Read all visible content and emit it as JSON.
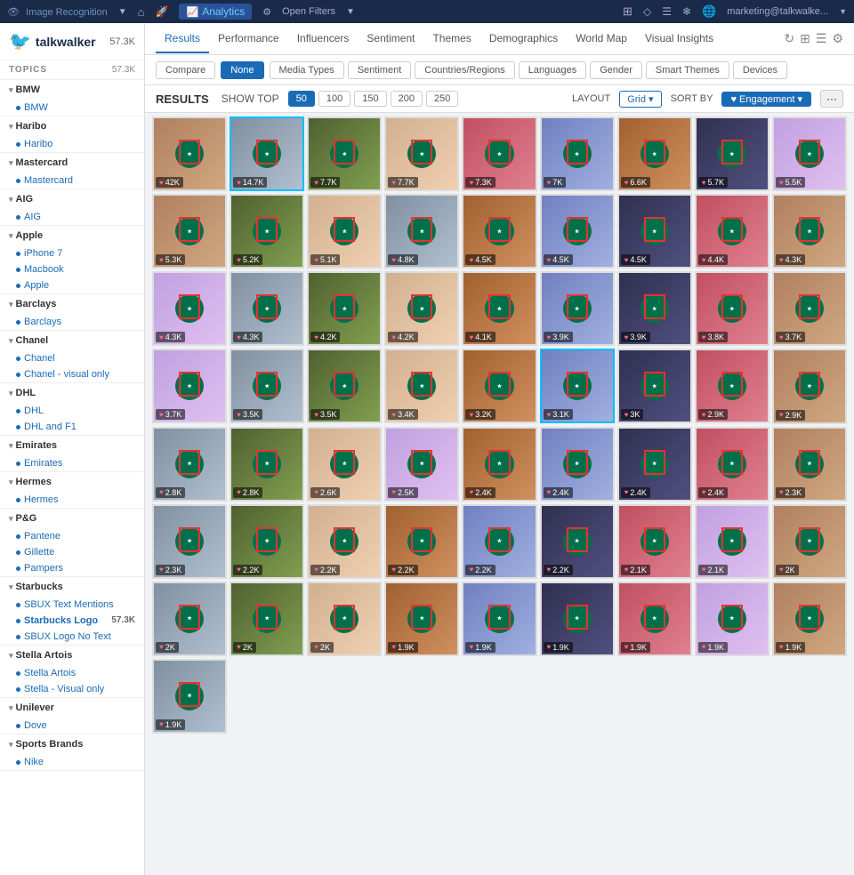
{
  "topnav": {
    "app_name": "Image Recognition",
    "analytics_tab": "Analytics",
    "open_filters": "Open Filters",
    "icons": [
      "home",
      "rocket",
      "analytics",
      "filter",
      "dropdown",
      "grid",
      "diamond",
      "document",
      "snowflake"
    ],
    "user": "marketing@talkwalke...",
    "globe_icon": "🌐"
  },
  "sidebar": {
    "logo_text": "talkwalker",
    "count": "57.3K",
    "topics_label": "TOPICS",
    "groups": [
      {
        "name": "BMW",
        "items": [
          {
            "label": "BMW",
            "count": ""
          }
        ]
      },
      {
        "name": "Haribo",
        "items": [
          {
            "label": "Haribo",
            "count": ""
          }
        ]
      },
      {
        "name": "Mastercard",
        "items": [
          {
            "label": "Mastercard",
            "count": ""
          }
        ]
      },
      {
        "name": "AIG",
        "items": [
          {
            "label": "AIG",
            "count": ""
          }
        ]
      },
      {
        "name": "Apple",
        "items": [
          {
            "label": "iPhone 7",
            "count": ""
          },
          {
            "label": "Macbook",
            "count": ""
          },
          {
            "label": "Apple",
            "count": ""
          }
        ]
      },
      {
        "name": "Barclays",
        "items": [
          {
            "label": "Barclays",
            "count": ""
          }
        ]
      },
      {
        "name": "Chanel",
        "items": [
          {
            "label": "Chanel",
            "count": ""
          },
          {
            "label": "Chanel - visual only",
            "count": ""
          }
        ]
      },
      {
        "name": "DHL",
        "items": [
          {
            "label": "DHL",
            "count": ""
          },
          {
            "label": "DHL and F1",
            "count": ""
          }
        ]
      },
      {
        "name": "Emirates",
        "items": [
          {
            "label": "Emirates",
            "count": ""
          }
        ]
      },
      {
        "name": "Hermes",
        "items": [
          {
            "label": "Hermes",
            "count": ""
          }
        ]
      },
      {
        "name": "P&G",
        "items": [
          {
            "label": "Pantene",
            "count": ""
          },
          {
            "label": "Gillette",
            "count": ""
          },
          {
            "label": "Pampers",
            "count": ""
          }
        ]
      },
      {
        "name": "Starbucks",
        "items": [
          {
            "label": "SBUX Text Mentions",
            "count": ""
          },
          {
            "label": "Starbucks Logo",
            "count": "57.3K",
            "active": true
          },
          {
            "label": "SBUX Logo No Text",
            "count": ""
          }
        ]
      },
      {
        "name": "Stella Artois",
        "items": [
          {
            "label": "Stella Artois",
            "count": ""
          },
          {
            "label": "Stella - Visual only",
            "count": ""
          }
        ]
      },
      {
        "name": "Unilever",
        "items": [
          {
            "label": "Dove",
            "count": ""
          }
        ]
      },
      {
        "name": "Sports Brands",
        "items": [
          {
            "label": "Nike",
            "count": ""
          }
        ]
      }
    ]
  },
  "subnav": {
    "items": [
      "Results",
      "Performance",
      "Influencers",
      "Sentiment",
      "Themes",
      "Demographics",
      "World Map",
      "Visual Insights"
    ]
  },
  "filterbar": {
    "compare_btn": "Compare",
    "none_btn": "None",
    "filters": [
      "Media Types",
      "Sentiment",
      "Countries/Regions",
      "Languages",
      "Gender",
      "Smart Themes",
      "Devices"
    ]
  },
  "results_toolbar": {
    "results_label": "RESULTS",
    "show_top_label": "SHOW TOP",
    "counts": [
      "50",
      "100",
      "150",
      "200",
      "250"
    ],
    "active_count": "50",
    "layout_label": "LAYOUT",
    "grid_btn": "Grid ▾",
    "sort_label": "SORT BY",
    "engagement_btn": "♥ Engagement ▾",
    "more_btn": "···"
  },
  "images": [
    {
      "count": "42K",
      "color": "c1"
    },
    {
      "count": "14.7K",
      "color": "c2",
      "highlighted": true
    },
    {
      "count": "7.7K",
      "color": "c3"
    },
    {
      "count": "7.7K",
      "color": "c4"
    },
    {
      "count": "7.3K",
      "color": "c5"
    },
    {
      "count": "7K",
      "color": "c6"
    },
    {
      "count": "6.6K",
      "color": "c7"
    },
    {
      "count": "5.7K",
      "color": "c8"
    },
    {
      "count": "5.5K",
      "color": "c9"
    },
    {
      "count": "5.3K",
      "color": "c1"
    },
    {
      "count": "5.2K",
      "color": "c3"
    },
    {
      "count": "5.1K",
      "color": "c4"
    },
    {
      "count": "4.8K",
      "color": "c2"
    },
    {
      "count": "4.5K",
      "color": "c7"
    },
    {
      "count": "4.5K",
      "color": "c6"
    },
    {
      "count": "4.5K",
      "color": "c8"
    },
    {
      "count": "4.4K",
      "color": "c5"
    },
    {
      "count": "4.3K",
      "color": "c1"
    },
    {
      "count": "4.3K",
      "color": "c9"
    },
    {
      "count": "4.3K",
      "color": "c2"
    },
    {
      "count": "4.2K",
      "color": "c3"
    },
    {
      "count": "4.2K",
      "color": "c4"
    },
    {
      "count": "4.1K",
      "color": "c7"
    },
    {
      "count": "3.9K",
      "color": "c6"
    },
    {
      "count": "3.9K",
      "color": "c8"
    },
    {
      "count": "3.8K",
      "color": "c5"
    },
    {
      "count": "3.7K",
      "color": "c1"
    },
    {
      "count": "3.7K",
      "color": "c9"
    },
    {
      "count": "3.5K",
      "color": "c2"
    },
    {
      "count": "3.5K",
      "color": "c3"
    },
    {
      "count": "3.4K",
      "color": "c4"
    },
    {
      "count": "3.2K",
      "color": "c7"
    },
    {
      "count": "3.1K",
      "color": "c6",
      "highlighted": true
    },
    {
      "count": "3K",
      "color": "c8"
    },
    {
      "count": "2.9K",
      "color": "c5"
    },
    {
      "count": "2.9K",
      "color": "c1"
    },
    {
      "count": "2.8K",
      "color": "c2"
    },
    {
      "count": "2.8K",
      "color": "c3"
    },
    {
      "count": "2.6K",
      "color": "c4"
    },
    {
      "count": "2.5K",
      "color": "c9"
    },
    {
      "count": "2.4K",
      "color": "c7"
    },
    {
      "count": "2.4K",
      "color": "c6"
    },
    {
      "count": "2.4K",
      "color": "c8"
    },
    {
      "count": "2.4K",
      "color": "c5"
    },
    {
      "count": "2.3K",
      "color": "c1"
    },
    {
      "count": "2.3K",
      "color": "c2"
    },
    {
      "count": "2.2K",
      "color": "c3"
    },
    {
      "count": "2.2K",
      "color": "c4"
    },
    {
      "count": "2.2K",
      "color": "c7"
    },
    {
      "count": "2.2K",
      "color": "c6"
    },
    {
      "count": "2.2K",
      "color": "c8"
    },
    {
      "count": "2.1K",
      "color": "c5"
    },
    {
      "count": "2.1K",
      "color": "c9"
    },
    {
      "count": "2K",
      "color": "c1"
    },
    {
      "count": "2K",
      "color": "c2"
    },
    {
      "count": "2K",
      "color": "c3"
    },
    {
      "count": "2K",
      "color": "c4"
    },
    {
      "count": "1.9K",
      "color": "c7"
    },
    {
      "count": "1.9K",
      "color": "c6"
    },
    {
      "count": "1.9K",
      "color": "c8"
    },
    {
      "count": "1.9K",
      "color": "c5"
    },
    {
      "count": "1.9K",
      "color": "c9"
    },
    {
      "count": "1.9K",
      "color": "c1"
    },
    {
      "count": "1.9K",
      "color": "c2"
    }
  ]
}
